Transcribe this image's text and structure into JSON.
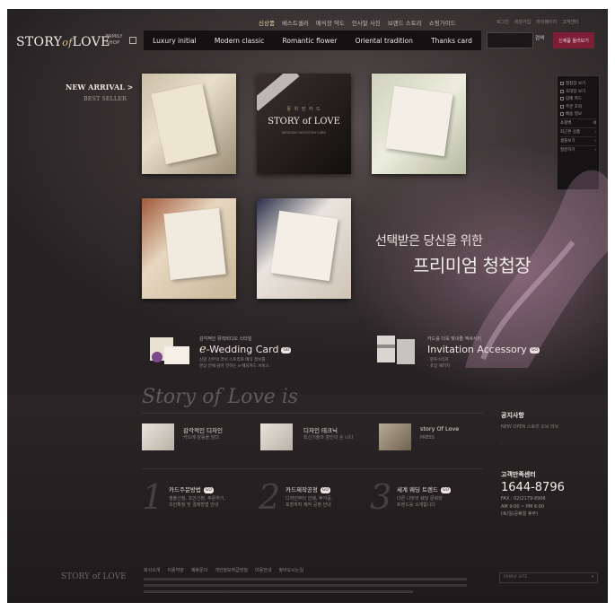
{
  "header": {
    "logo": {
      "text_before": "STORY",
      "text_script": "of",
      "text_after": "LOVE"
    },
    "family_shop_label": "FAMILY SHOP",
    "top_nav": [
      "신상품",
      "베스트셀러",
      "예식장 약도",
      "인사말 사진",
      "브랜드 스토리",
      "쇼핑가이드"
    ],
    "utility_links": [
      "로그인",
      "회원가입",
      "마이페이지",
      "고객센터"
    ],
    "main_menu": [
      "Luxury initial",
      "Modern classic",
      "Romantic flower",
      "Oriental tradition",
      "Thanks card"
    ],
    "search_placeholder": "",
    "search_button": "검색",
    "promo_button": "신제품 둘러보기"
  },
  "sidebar_left": {
    "new_arrival": "NEW ARRIVAL >",
    "best_seller": "BEST SELLER"
  },
  "right_panel": {
    "checklist": [
      "청첩장 보기",
      "초대장 보기",
      "답례 카드",
      "주문 조회",
      "배송 정보"
    ],
    "rows": [
      {
        "label": "쇼핑백",
        "value": "0"
      },
      {
        "label": "최근본 상품",
        "value": "›"
      },
      {
        "label": "샘플보기",
        "value": "›"
      },
      {
        "label": "질문하기",
        "value": "›"
      }
    ]
  },
  "gallery": {
    "featured_card": {
      "title": "몽 위 앙 카 드",
      "logo": "STORY of LOVE",
      "subtitle": "WEDDING INVITATION CARD"
    }
  },
  "hero": {
    "line1": "선택받은 당신을 위한",
    "line2": "프리미엄 청첩장"
  },
  "promos": [
    {
      "label": "감각적인 뮤직비디오 스타일",
      "title_prefix": "e",
      "title": "-Wedding Card",
      "go": "GO",
      "desc": [
        "신랑 신부의 러브 스토리와 예식 정보를",
        "영상 안에 담아 전하는 e-웨딩카드 서비스"
      ]
    },
    {
      "label": "카드를 더욱 빛내줄 액세서리",
      "title_prefix": "",
      "title": "Invitation Accessory",
      "go": "GO",
      "desc": [
        "· 봉투스티커",
        "· 포장 패키지"
      ]
    }
  ],
  "story_section": {
    "script_title": "Story of Love is",
    "features": [
      {
        "title": "감각적인 디자인",
        "desc": "카드에 감동을 담다."
      },
      {
        "title": "디자인 테크닉",
        "desc": "최신기술과 장인의 손 니다"
      },
      {
        "title": "story Of Love",
        "desc": "PRESS"
      }
    ],
    "guides": [
      {
        "num": "1",
        "title": "카드주문방법",
        "go": "GO",
        "desc": [
          "샘플신청, 초안신청, 주문하기,",
          "초안확정 및 결제방법 안내"
        ]
      },
      {
        "num": "2",
        "title": "카드제작공정",
        "go": "GO",
        "desc": [
          "디자인부터 인쇄, 후가공,",
          "포장까지 제작 공정 안내"
        ]
      },
      {
        "num": "3",
        "title": "세계 웨딩 트렌드",
        "go": "GO",
        "desc": [
          "다른 나라의 웨딩 문화와",
          "트렌드를 소개합니다"
        ]
      }
    ]
  },
  "notice": {
    "title": "공지사항",
    "items": [
      "NEW OPEN 스토리 오브 러브",
      "·",
      "·"
    ]
  },
  "customer_center": {
    "title": "고객만족센터",
    "phone": "1644-8796",
    "fax": "FAX : 02)2179-8906",
    "hours": "AM 9:00 ~ PM 6:00",
    "note": "(토/일/공휴일 휴무)"
  },
  "footer": {
    "logo": "STORY of LOVE",
    "links": [
      "회사소개",
      "이용약관",
      "제휴문의",
      "개인정보취급방침",
      "이용안내",
      "찾아오시는길"
    ],
    "family_select": "FAMILY SITE"
  },
  "colors": {
    "accent": "#7c1e36",
    "gold": "#e7d9a8",
    "background": "#2a2526",
    "menu_bar": "#141112"
  }
}
